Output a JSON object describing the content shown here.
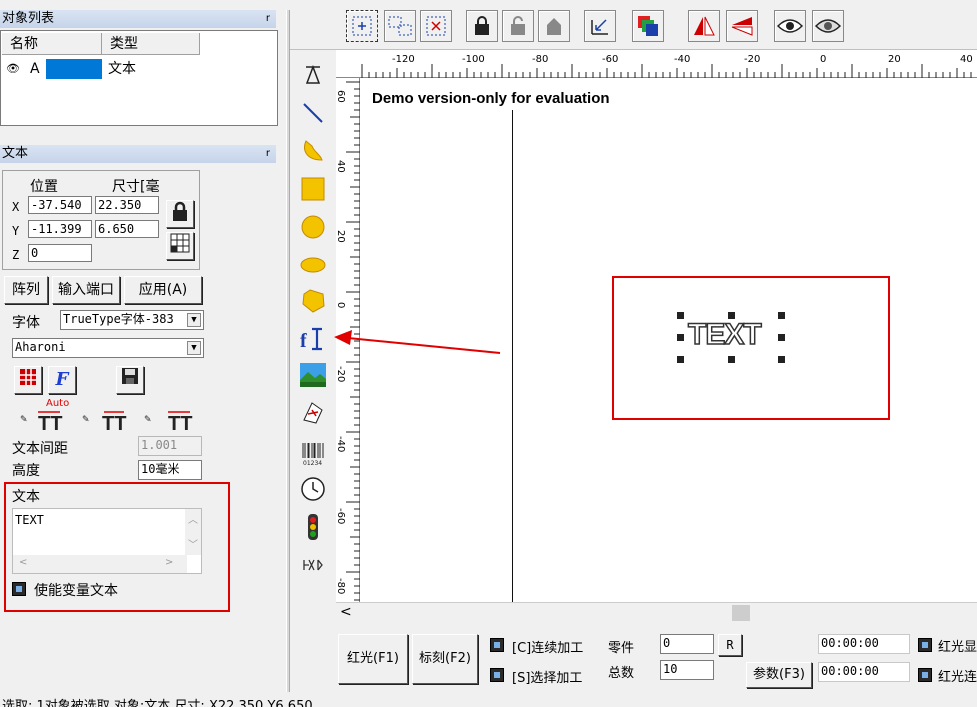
{
  "object_list": {
    "title": "对象列表",
    "pin": "r",
    "col_name": "名称",
    "col_type": "类型",
    "row_name": "A",
    "row_type": "文本"
  },
  "props": {
    "title": "文本",
    "pin": "r",
    "position_label": "位置",
    "size_label": "尺寸[毫",
    "x_label": "X",
    "y_label": "Y",
    "z_label": "Z",
    "x_value": "-37.540",
    "y_value": "-11.399",
    "z_value": "0",
    "width_value": "22.350",
    "height_value": "6.650",
    "array_btn": "阵列",
    "input_port_btn": "输入端口",
    "apply_btn": "应用(A)",
    "font_label": "字体",
    "font_type": "TrueType字体-383",
    "font_name": "Aharoni",
    "auto_label": "Auto",
    "spacing_label": "文本间距",
    "spacing_value": "1.001",
    "height_label": "高度",
    "height_field": "10毫米",
    "text_label": "文本",
    "text_value": "TEXT",
    "variable_text": "使能变量文本"
  },
  "canvas": {
    "demo_text": "Demo version-only for evaluation",
    "object_text": "TEXT",
    "h_ruler": [
      "-120",
      "-100",
      "-80",
      "-60",
      "-40",
      "-20",
      "0",
      "20",
      "40"
    ],
    "v_ruler": [
      "60",
      "40",
      "20",
      "0",
      "-20",
      "-40",
      "-60",
      "-80"
    ]
  },
  "bottom": {
    "red_light_btn": "红光(F1)",
    "mark_btn": "标刻(F2)",
    "continuous": "[C]连续加工",
    "selective": "[S]选择加工",
    "parts_label": "零件",
    "parts_value": "0",
    "r_btn": "R",
    "total_label": "总数",
    "total_value": "10",
    "params_btn": "参数(F3)",
    "time1": "00:00:00",
    "time2": "00:00:00",
    "red_display": "红光显",
    "red_cont": "红光连"
  },
  "status": {
    "text": "选取: 1对象被选取 对象:文本 尺寸: X22.350 Y6.650"
  },
  "colors": {
    "accent_red": "#e00000",
    "selection_blue": "#0078d7"
  }
}
